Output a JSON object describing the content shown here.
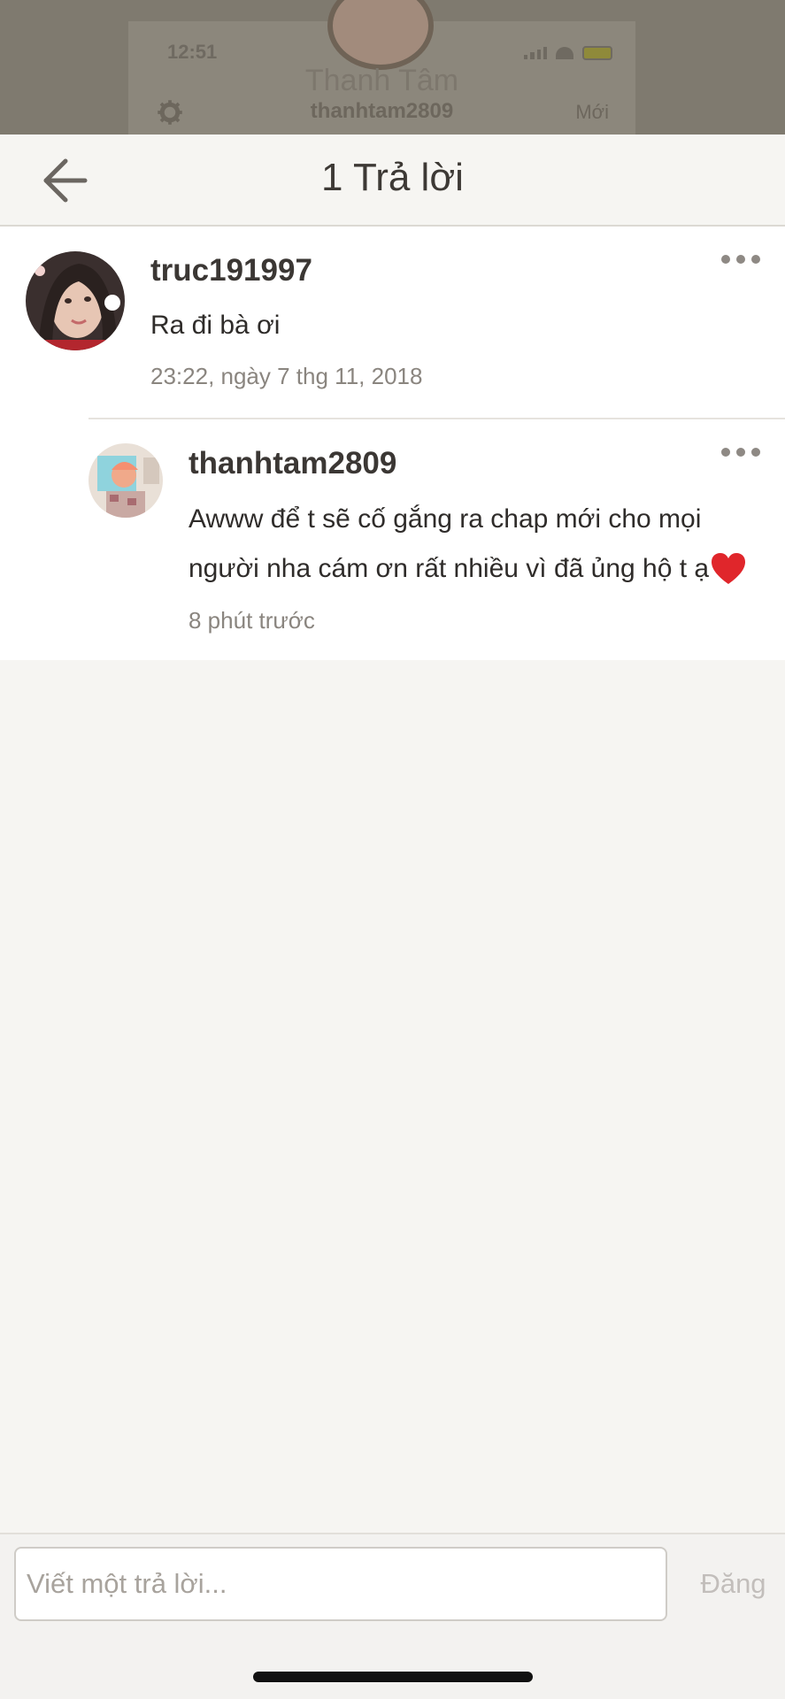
{
  "background": {
    "time": "12:51",
    "display_name": "Thanh Tâm",
    "username": "thanhtam2809",
    "new_label": "Mới"
  },
  "header": {
    "title": "1 Trả lời",
    "back_icon": "arrow-left-icon"
  },
  "comments": [
    {
      "username": "truc191997",
      "text": "Ra đi bà ơi",
      "time": "23:22, ngày 7 thg 11, 2018",
      "more_icon": "more-dots-icon"
    }
  ],
  "replies": [
    {
      "username": "thanhtam2809",
      "text_line1": "Awww để t sẽ cố gắng ra chap mới cho mọi",
      "text_line2": "người nha cám ơn rất nhiều vì đã ủng hộ t ạ",
      "emoji_icon": "heart-icon",
      "time": "8 phút trước",
      "more_icon": "more-dots-icon"
    }
  ],
  "composer": {
    "placeholder": "Viết một trả lời...",
    "post_label": "Đăng"
  },
  "colors": {
    "background": "#f6f5f2",
    "card": "#ffffff",
    "heart": "#e0262b"
  }
}
